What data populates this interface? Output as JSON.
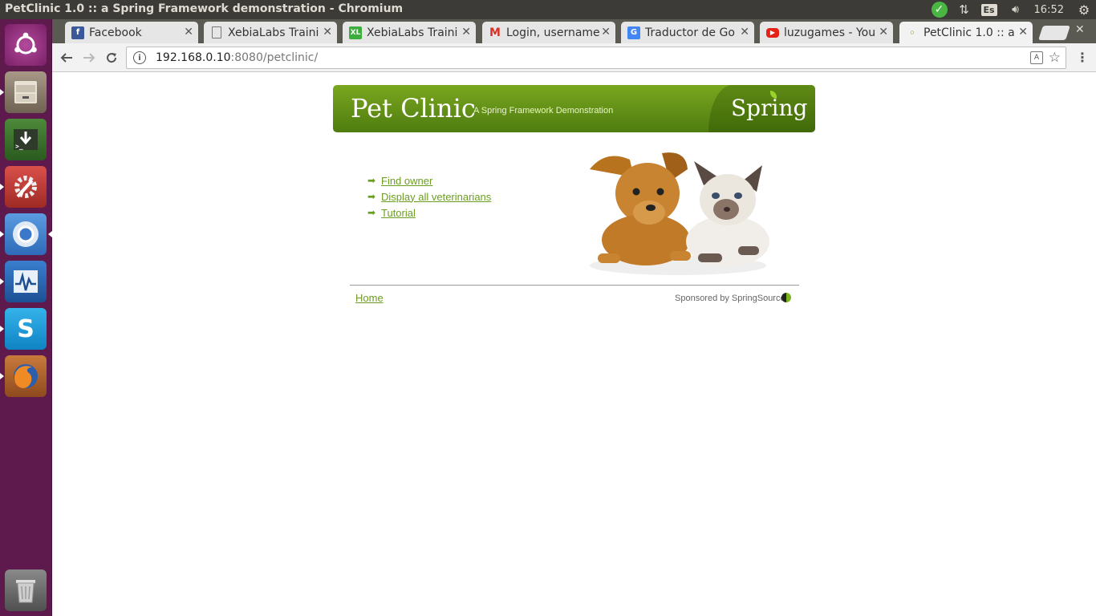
{
  "window": {
    "title": "PetClinic 1.0 :: a Spring Framework demonstration - Chromium"
  },
  "panel": {
    "keyboard_layout": "Es",
    "time": "16:52"
  },
  "launcher": {
    "items": [
      {
        "name": "ubuntu-dash",
        "icon": "ubuntu-logo-icon",
        "color": "#8e2e7a"
      },
      {
        "name": "files",
        "icon": "file-cabinet-icon",
        "color": "#8a7b6a"
      },
      {
        "name": "software-updater",
        "icon": "download-terminal-icon",
        "color": "#3b6e2d"
      },
      {
        "name": "system-settings",
        "icon": "wrench-gear-icon",
        "color": "#c8413a"
      },
      {
        "name": "chromium",
        "icon": "chromium-icon",
        "color": "#3b78c9"
      },
      {
        "name": "system-monitor",
        "icon": "heartbeat-monitor-icon",
        "color": "#2a67b3"
      },
      {
        "name": "skype",
        "icon": "skype-icon",
        "color": "#1ea0de"
      },
      {
        "name": "firefox",
        "icon": "firefox-icon",
        "color": "#e0701f"
      },
      {
        "name": "trash",
        "icon": "trash-icon",
        "color": "#6b6b6b"
      }
    ]
  },
  "tabs": [
    {
      "label": "Facebook",
      "favicon": "F",
      "favicon_color": "#3b5998"
    },
    {
      "label": "XebiaLabs Traini",
      "favicon": "doc",
      "favicon_color": "#777777"
    },
    {
      "label": "XebiaLabs Traini",
      "favicon": "XL",
      "favicon_color": "#3cae3c"
    },
    {
      "label": "Login, username",
      "favicon": "M",
      "favicon_color": "#d93025"
    },
    {
      "label": "Traductor de Go",
      "favicon": "G",
      "favicon_color": "#4285f4"
    },
    {
      "label": "luzugames - You",
      "favicon": "▶",
      "favicon_color": "#e62117"
    },
    {
      "label": "PetClinic 1.0 :: a",
      "favicon": "◦",
      "favicon_color": "#6b9e1f"
    }
  ],
  "address_bar": {
    "host": "192.168.0.10",
    "path": ":8080/petclinic/"
  },
  "page": {
    "banner_title": "Pet Clinic",
    "banner_subtitle": "A Spring Framework Demonstration",
    "brand": "Spring",
    "links": [
      "Find owner",
      "Display all veterinarians",
      "Tutorial"
    ],
    "footer_home": "Home",
    "sponsor": "Sponsored by SpringSource",
    "link_color": "#6b9e1f"
  }
}
